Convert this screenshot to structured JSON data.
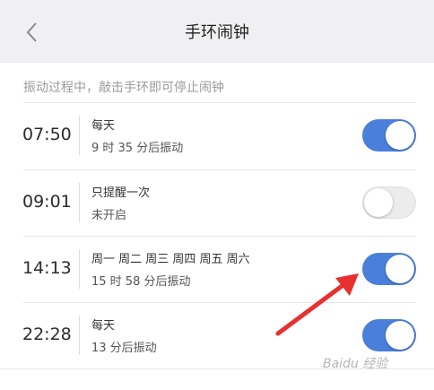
{
  "nav": {
    "title": "手环闹钟"
  },
  "hint": "振动过程中，敲击手环即可停止闹钟",
  "alarms": [
    {
      "time": "07:50",
      "repeat": "每天",
      "status": "9 时 35 分后振动",
      "enabled": true
    },
    {
      "time": "09:01",
      "repeat": "只提醒一次",
      "status": "未开启",
      "enabled": false
    },
    {
      "time": "14:13",
      "repeat": "周一 周二 周三 周四 周五 周六",
      "status": "15 时 58 分后振动",
      "enabled": true
    },
    {
      "time": "22:28",
      "repeat": "每天",
      "status": "13 分后振动",
      "enabled": true
    }
  ],
  "colors": {
    "toggle_on": "#4a7fdb",
    "toggle_off": "#ececec",
    "arrow": "#e8312f"
  },
  "icons": {
    "back": "chevron-left-icon",
    "annotation": "red-arrow-icon"
  },
  "watermark": "Baidu 经验"
}
